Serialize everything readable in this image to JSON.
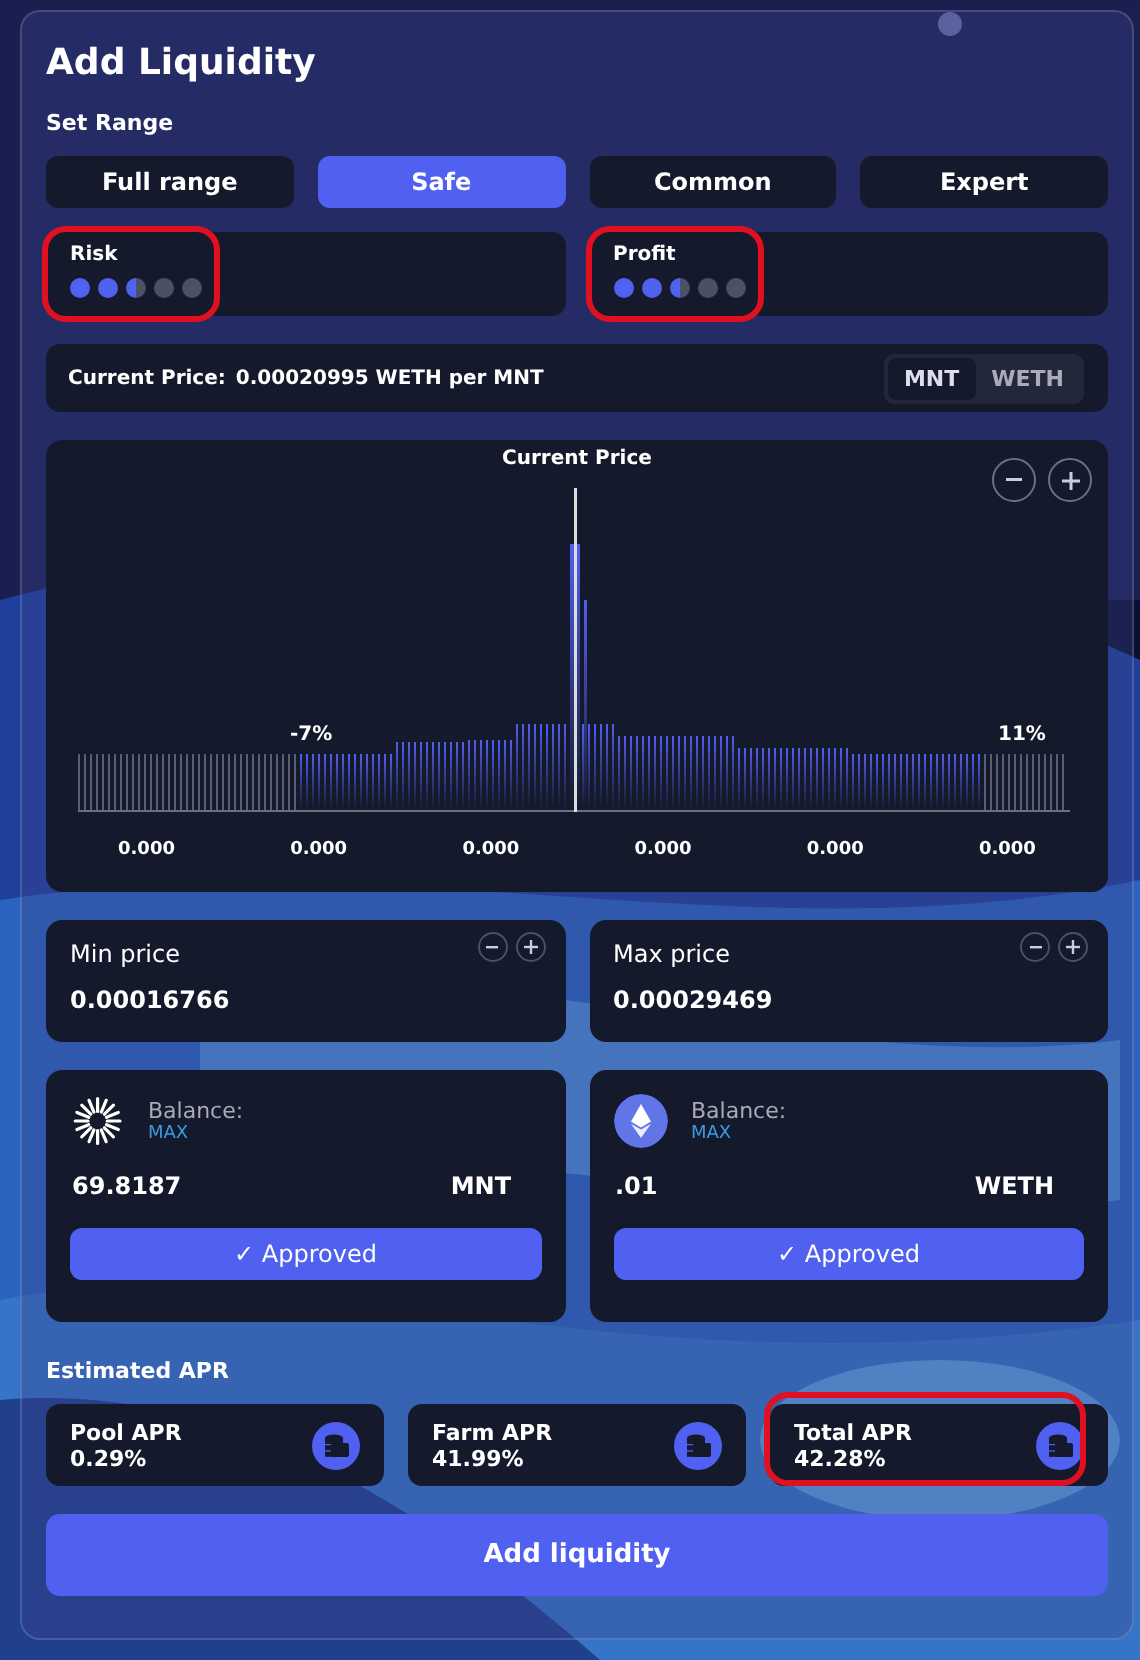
{
  "title": "Add Liquidity",
  "range": {
    "label": "Set Range",
    "options": [
      {
        "label": "Full range",
        "selected": false
      },
      {
        "label": "Safe",
        "selected": true
      },
      {
        "label": "Common",
        "selected": false
      },
      {
        "label": "Expert",
        "selected": false
      }
    ]
  },
  "meters": [
    {
      "label": "Risk",
      "stars": 2.5,
      "highlighted": true
    },
    {
      "label": "Profit",
      "stars": 2.5,
      "highlighted": true
    }
  ],
  "current_price": {
    "label": "Current Price:",
    "value": "0.00020995 WETH per MNT",
    "units": [
      {
        "label": "MNT",
        "selected": true
      },
      {
        "label": "WETH",
        "selected": false
      }
    ]
  },
  "histogram": {
    "title": "Current Price",
    "lower_bound": "-7%",
    "upper_bound": "11%",
    "ticks": [
      "0.000",
      "0.000",
      "0.000",
      "0.000",
      "0.000",
      "0.000"
    ]
  },
  "bounds": [
    {
      "label": "Min price",
      "value": "0.00016766"
    },
    {
      "label": "Max price",
      "value": "0.00029469"
    }
  ],
  "tokens": [
    {
      "kind": "mantle",
      "balance_label": "Balance:",
      "max": "MAX",
      "amount": "69.8187",
      "symbol": "MNT",
      "approval": "✓ Approved"
    },
    {
      "kind": "ether",
      "balance_label": "Balance:",
      "max": "MAX",
      "amount": ".01",
      "symbol": "WETH",
      "approval": "✓ Approved"
    }
  ],
  "apr": {
    "label": "Estimated APR",
    "items": [
      {
        "label": "Pool APR",
        "value": "0.29%",
        "highlighted": false
      },
      {
        "label": "Farm APR",
        "value": "41.99%",
        "highlighted": false
      },
      {
        "label": "Total APR",
        "value": "42.28%",
        "highlighted": true
      }
    ]
  },
  "submit": "Add liquidity"
}
